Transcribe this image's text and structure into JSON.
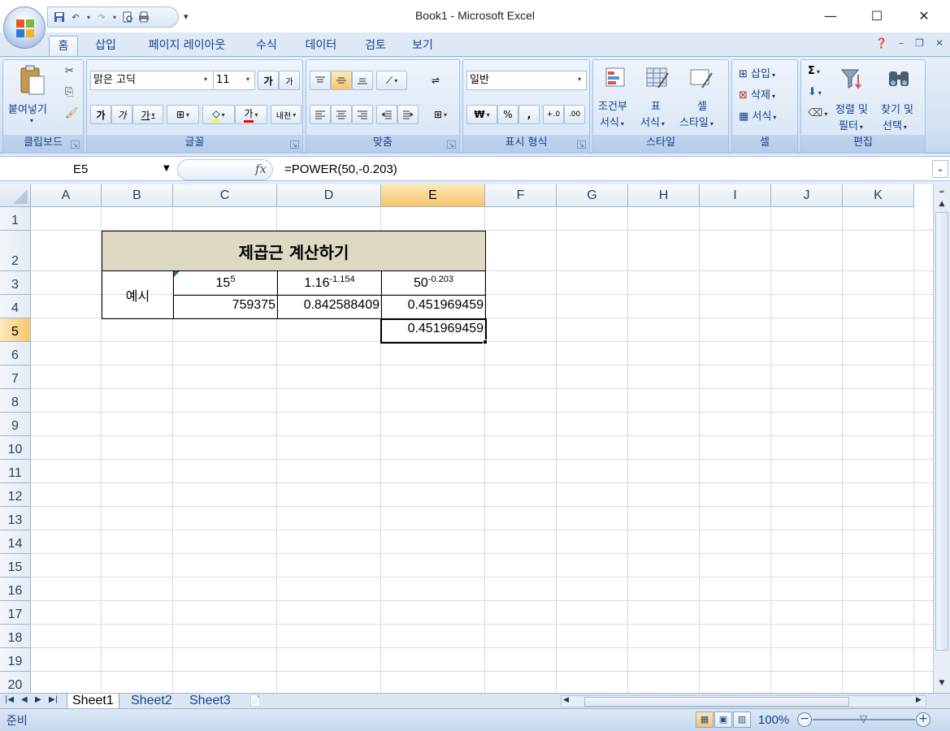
{
  "window": {
    "title": "Book1 - Microsoft Excel",
    "min": "—",
    "max": "☐",
    "close": "✕"
  },
  "qat": {
    "save": "💾",
    "undo": "↶",
    "redo": "↷",
    "preview": "🔍",
    "print": "🖨",
    "more": "▾"
  },
  "tabs": [
    "홈",
    "삽입",
    "페이지 레이아웃",
    "수식",
    "데이터",
    "검토",
    "보기"
  ],
  "active_tab": "홈",
  "ribbon": {
    "clipboard": {
      "label": "클립보드",
      "paste": "붙여넣기",
      "cut": "✂",
      "copy": "⎘",
      "format_painter": "🖌"
    },
    "font": {
      "label": "글꼴",
      "name": "맑은 고딕",
      "size": "11",
      "grow": "가",
      "shrink": "가",
      "bold": "가",
      "italic": "가",
      "underline": "가",
      "border": "⊞",
      "fill": "◇",
      "color": "가",
      "phonetic": "내천"
    },
    "alignment": {
      "label": "맞춤",
      "wrap": "⇌",
      "merge": "⊞"
    },
    "number": {
      "label": "표시 형식",
      "format": "일반",
      "currency": "₩",
      "percent": "%",
      "comma": ",",
      "inc": "+.0",
      "dec": ".00"
    },
    "styles": {
      "label": "스타일",
      "conditional": "조건부",
      "conditional2": "서식",
      "table": "표",
      "table2": "서식",
      "cell": "셀",
      "cell2": "스타일"
    },
    "cells": {
      "label": "셀",
      "insert": "삽입",
      "delete": "삭제",
      "format": "서식"
    },
    "editing": {
      "label": "편집",
      "sum": "Σ",
      "fill": "⬇",
      "clear": "⌫",
      "sort": "정렬 및",
      "sort2": "필터",
      "find": "찾기 및",
      "find2": "선택"
    }
  },
  "formula_bar": {
    "name_box": "E5",
    "fx": "fx",
    "formula": "=POWER(50,-0.203)"
  },
  "columns": [
    "A",
    "B",
    "C",
    "D",
    "E",
    "F",
    "G",
    "H",
    "I",
    "J",
    "K"
  ],
  "selected_column": "E",
  "rows": [
    "1",
    "2",
    "3",
    "4",
    "5",
    "6",
    "7",
    "8",
    "9",
    "10",
    "11",
    "12",
    "13",
    "14",
    "15",
    "16",
    "17",
    "18",
    "19",
    "20"
  ],
  "selected_row": "5",
  "cells": {
    "B2": "제곱근 계산하기",
    "B3": "예시",
    "C3_base": "15",
    "C3_exp": "5",
    "D3_base": "1.16",
    "D3_exp": "-1.154",
    "E3_base": "50",
    "E3_exp": "-0.203",
    "C4": "759375",
    "D4": "0.842588409",
    "E4": "0.451969459",
    "E5": "0.451969459"
  },
  "title_fill_color": "#ddd9c3",
  "sheets": [
    "Sheet1",
    "Sheet2",
    "Sheet3"
  ],
  "active_sheet": "Sheet1",
  "status": {
    "text": "준비",
    "zoom": "100%"
  }
}
